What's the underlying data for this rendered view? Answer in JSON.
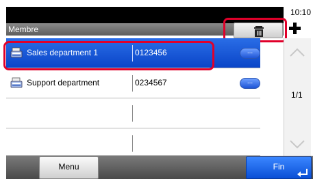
{
  "status": {
    "time": "10:10"
  },
  "header": {
    "title": "Membre"
  },
  "toolbar": {
    "delete_icon": "trash-icon",
    "add_icon": "plus-icon"
  },
  "list": {
    "rows": [
      {
        "name": "Sales department 1",
        "number": "0123456",
        "detail_label": "...",
        "selected": true,
        "icon": "fax-machine-icon"
      },
      {
        "name": "Support department",
        "number": "0234567",
        "detail_label": "...",
        "selected": false,
        "icon": "fax-machine-icon"
      },
      {
        "name": "",
        "number": "",
        "detail_label": "",
        "selected": false,
        "icon": ""
      },
      {
        "name": "",
        "number": "",
        "detail_label": "",
        "selected": false,
        "icon": ""
      }
    ]
  },
  "pagination": {
    "page": "1/1"
  },
  "footer": {
    "menu_label": "Menu",
    "fin_label": "Fin",
    "enter_icon": "enter-arrow-icon"
  },
  "colors": {
    "selection": "#0a45c8",
    "highlight": "#e0002a",
    "primary_button": "#0a4fd6"
  }
}
